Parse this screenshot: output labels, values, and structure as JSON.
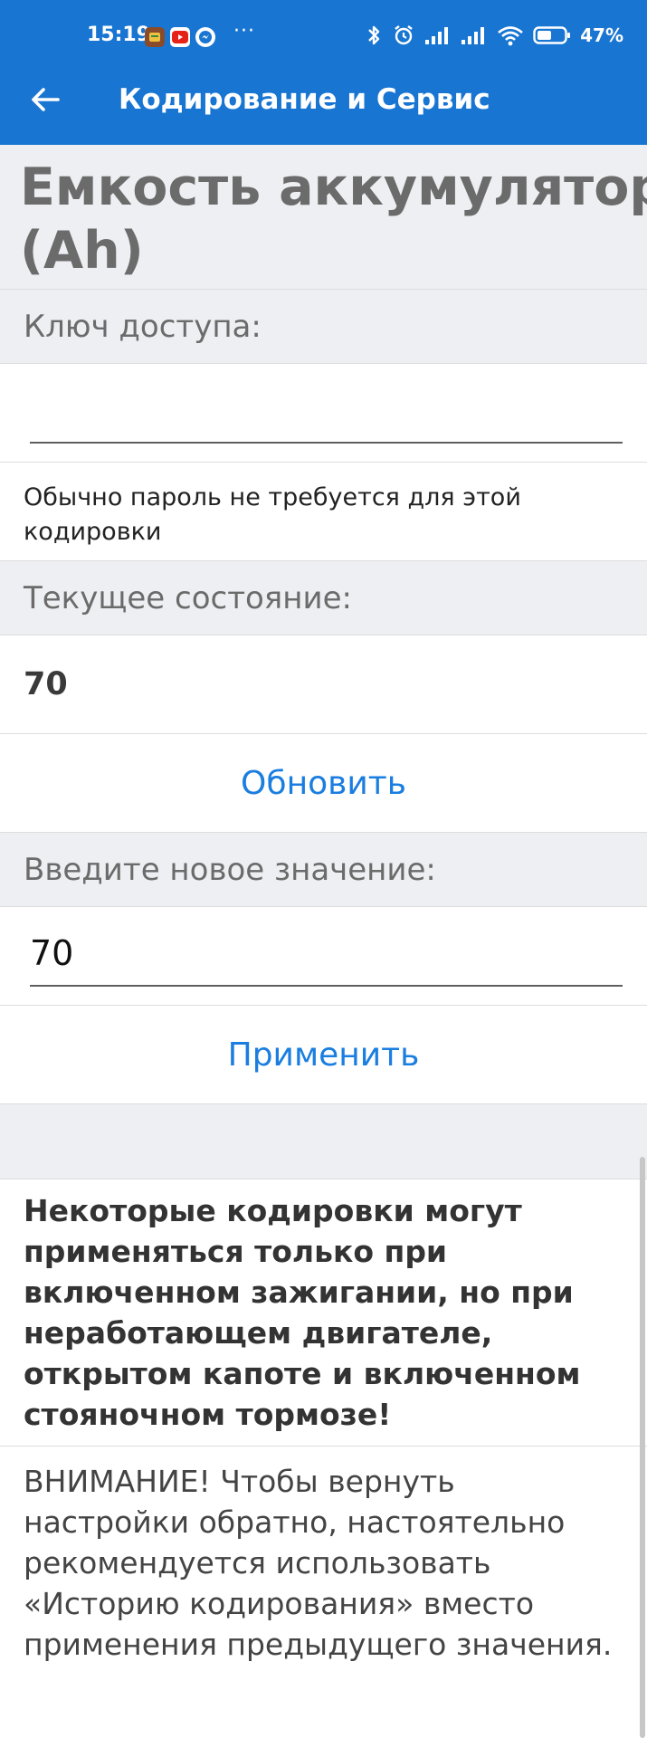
{
  "status_bar": {
    "time": "15:19",
    "battery_percent": "47%",
    "icons": [
      "app-notification-icon",
      "youtube-icon",
      "messenger-icon",
      "bluetooth-icon",
      "alarm-icon",
      "signal-icon",
      "signal-icon",
      "wifi-icon",
      "battery-icon"
    ],
    "more": "···"
  },
  "app_bar": {
    "back_icon": "arrow-left-icon",
    "title": "Кодирование и Сервис",
    "background": "#1975d2"
  },
  "page": {
    "heading_line1": "Емкость аккумулятора",
    "heading_line2": "(Ah)"
  },
  "access_key": {
    "label": "Ключ доступа:",
    "value": "",
    "hint": "Обычно пароль не требуется для этой кодировки"
  },
  "current_state": {
    "label": "Текущее состояние:",
    "value": "70",
    "refresh_label": "Обновить"
  },
  "new_value": {
    "label": "Введите новое значение:",
    "value": "70",
    "apply_label": "Применить"
  },
  "warnings": {
    "ignition_note": "Некоторые кодировки могут применяться только при включенном зажигании, но при неработающем двигателе, открытом капоте и включенном стояночном тормозе!",
    "history_note": "ВНИМАНИЕ! Чтобы вернуть настройки обратно, настоятельно рекомендуется использовать «Историю кодирования» вместо применения предыдущего значения."
  },
  "colors": {
    "accent": "#1975d2",
    "link": "#1a7ee0",
    "section_background": "#eeeff2"
  }
}
